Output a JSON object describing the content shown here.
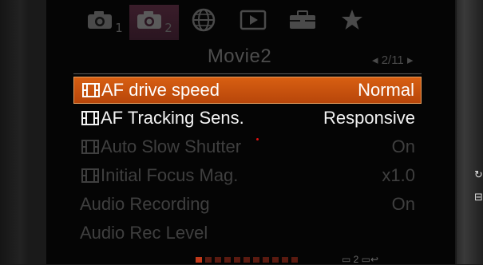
{
  "tabs": [
    {
      "icon": "camera-icon",
      "glyph": "📷",
      "sub": "1",
      "active": false
    },
    {
      "icon": "camera-icon",
      "glyph": "📷",
      "sub": "2",
      "active": true
    },
    {
      "icon": "globe-icon",
      "glyph": "🌐",
      "sub": "",
      "active": false
    },
    {
      "icon": "playback-icon",
      "glyph": "▶",
      "sub": "",
      "active": false
    },
    {
      "icon": "toolbox-icon",
      "glyph": "🧰",
      "sub": "",
      "active": false
    },
    {
      "icon": "star-icon",
      "glyph": "★",
      "sub": "",
      "active": false
    }
  ],
  "page": {
    "title": "Movie2",
    "indicator": "◂ 2/11 ▸"
  },
  "menu": {
    "items": [
      {
        "label": "AF drive speed",
        "value": "Normal",
        "movie_icon": true,
        "state": "selected"
      },
      {
        "label": "AF Tracking Sens.",
        "value": "Responsive",
        "movie_icon": true,
        "state": "enabled"
      },
      {
        "label": "Auto Slow Shutter",
        "value": "On",
        "movie_icon": true,
        "state": "disabled"
      },
      {
        "label": "Initial Focus Mag.",
        "value": "x1.0",
        "movie_icon": true,
        "state": "disabled"
      },
      {
        "label": "Audio Recording",
        "value": "On",
        "movie_icon": false,
        "state": "disabled"
      },
      {
        "label": "Audio Rec Level",
        "value": "",
        "movie_icon": false,
        "state": "disabled"
      }
    ]
  },
  "footer": {
    "icons_text": "▭ 2  ▭↩"
  },
  "side": {
    "icon1": "↻",
    "icon2": "⊟"
  },
  "colors": {
    "selected_bg": "#c9500e",
    "enabled_text": "#f2f2f2",
    "disabled_text": "#3f3f3f",
    "active_tab": "#6b2a44"
  }
}
